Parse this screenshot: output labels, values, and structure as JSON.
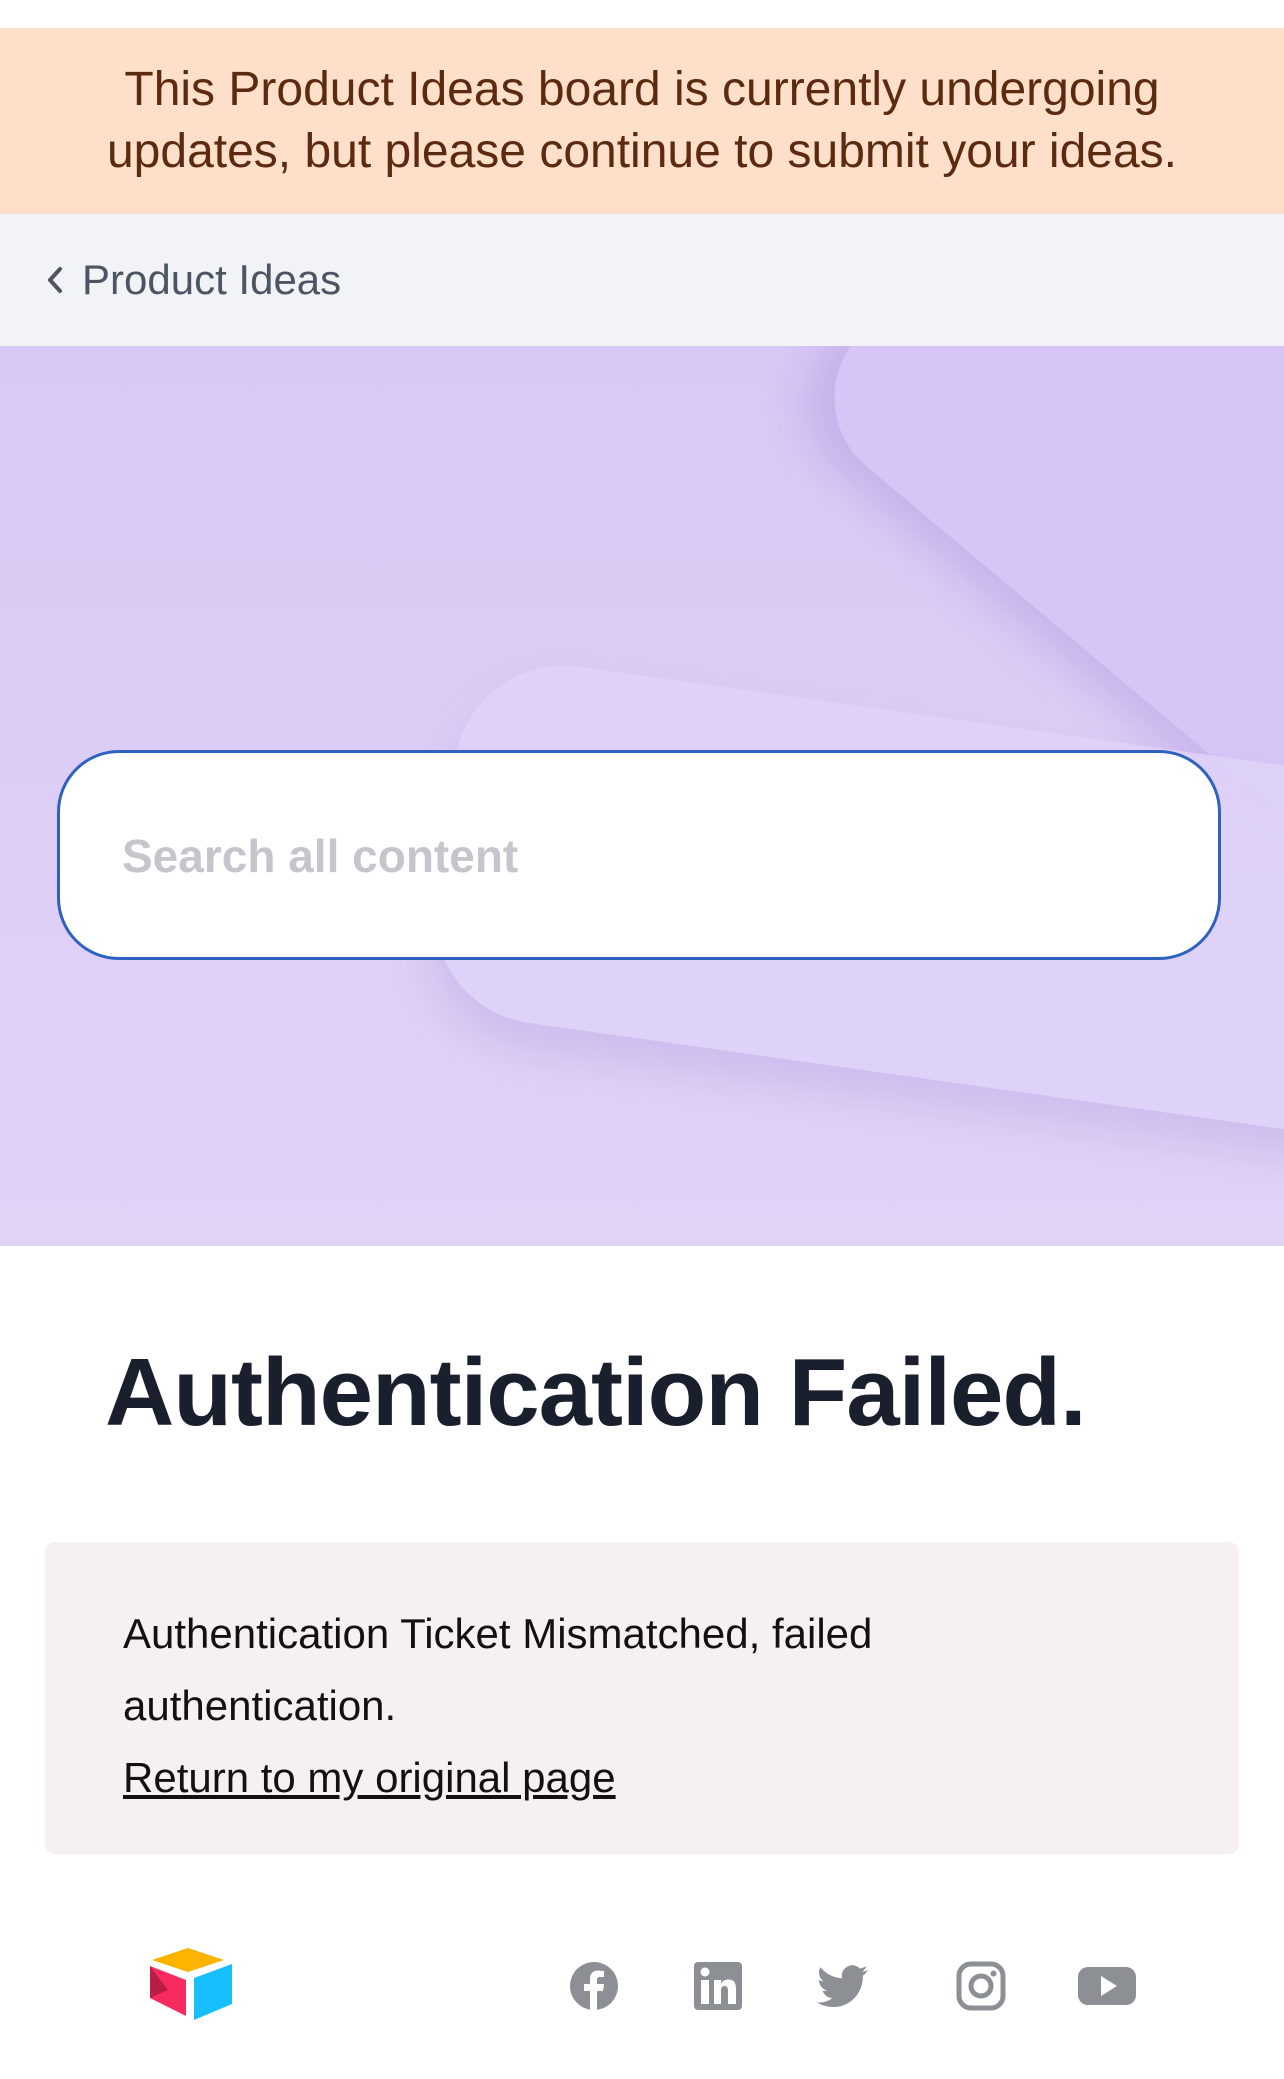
{
  "announcement": {
    "text": "This Product Ideas board is currently undergoing updates, but please continue to submit your ideas."
  },
  "breadcrumb": {
    "back_label": "Product Ideas"
  },
  "search": {
    "placeholder": "Search all content",
    "value": ""
  },
  "page": {
    "title": "Authentication Failed."
  },
  "error": {
    "message": "Authentication Ticket Mismatched, failed authentication.",
    "link_label": "Return to my original page"
  },
  "footer": {
    "logo_icon": "airtable-logo-icon",
    "social_icons": [
      "facebook-icon",
      "linkedin-icon",
      "twitter-icon",
      "instagram-icon",
      "youtube-icon"
    ]
  },
  "colors": {
    "announcement_bg": "#fddfca",
    "announcement_text": "#5c2a0e",
    "hero_bg": "#d8c8f5",
    "search_border": "#2f62c0",
    "error_bg": "#f7f0f2",
    "social_icon": "#8c8f94"
  }
}
